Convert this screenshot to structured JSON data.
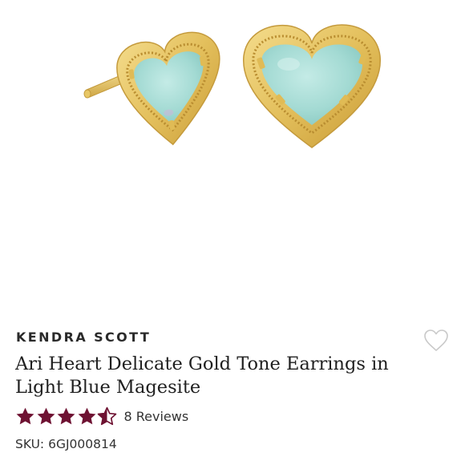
{
  "product": {
    "brand": "KENDRA SCOTT",
    "title": "Ari Heart Delicate Gold Tone Earrings in Light Blue Magesite",
    "rating": {
      "value": 4.5,
      "max": 5,
      "reviews_label": "8 Reviews"
    },
    "sku_label": "SKU: 6GJ000814"
  },
  "icons": {
    "wishlist": "heart-outline-icon",
    "rating_star": "star-icon"
  },
  "colors": {
    "star": "#6e1232",
    "wishlist": "#c9c9c9",
    "gold": "#e8c766",
    "stone": "#a6dcd6"
  }
}
